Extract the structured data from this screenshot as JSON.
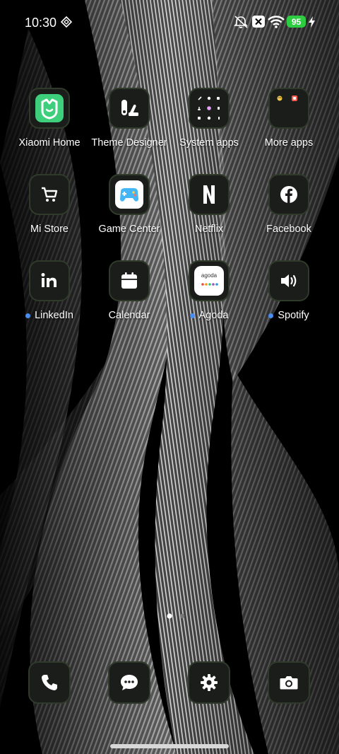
{
  "status_bar": {
    "time": "10:30",
    "battery": "95",
    "icons": [
      "location-diamond-icon",
      "vibrate-icon",
      "notification-x-icon",
      "wifi-icon",
      "charging-icon"
    ]
  },
  "apps": [
    {
      "name": "Xiaomi Home",
      "icon": "xiaomi-home-icon",
      "dot": false
    },
    {
      "name": "Theme Designer",
      "icon": "theme-designer-icon",
      "dot": false
    },
    {
      "name": "System apps",
      "icon": "folder-icon",
      "dot": false
    },
    {
      "name": "More apps",
      "icon": "folder-icon",
      "dot": false
    },
    {
      "name": "Mi Store",
      "icon": "cart-icon",
      "dot": false
    },
    {
      "name": "Game Center",
      "icon": "gamepad-icon",
      "dot": false
    },
    {
      "name": "Netflix",
      "icon": "netflix-icon",
      "dot": false
    },
    {
      "name": "Facebook",
      "icon": "facebook-icon",
      "dot": false
    },
    {
      "name": "LinkedIn",
      "icon": "linkedin-icon",
      "dot": true
    },
    {
      "name": "Calendar",
      "icon": "calendar-icon",
      "dot": false
    },
    {
      "name": "Agoda",
      "icon": "agoda-icon",
      "dot": true
    },
    {
      "name": "Spotify",
      "icon": "speaker-icon",
      "dot": true
    }
  ],
  "agoda_logo_text": "agoda",
  "dock": [
    {
      "icon": "phone-icon"
    },
    {
      "icon": "messages-icon"
    },
    {
      "icon": "settings-icon"
    },
    {
      "icon": "camera-icon"
    }
  ],
  "colors": {
    "battery": "#2ecc40",
    "notification_dot": "#4a8cf0",
    "tile_bg": "#1b1d1b"
  }
}
